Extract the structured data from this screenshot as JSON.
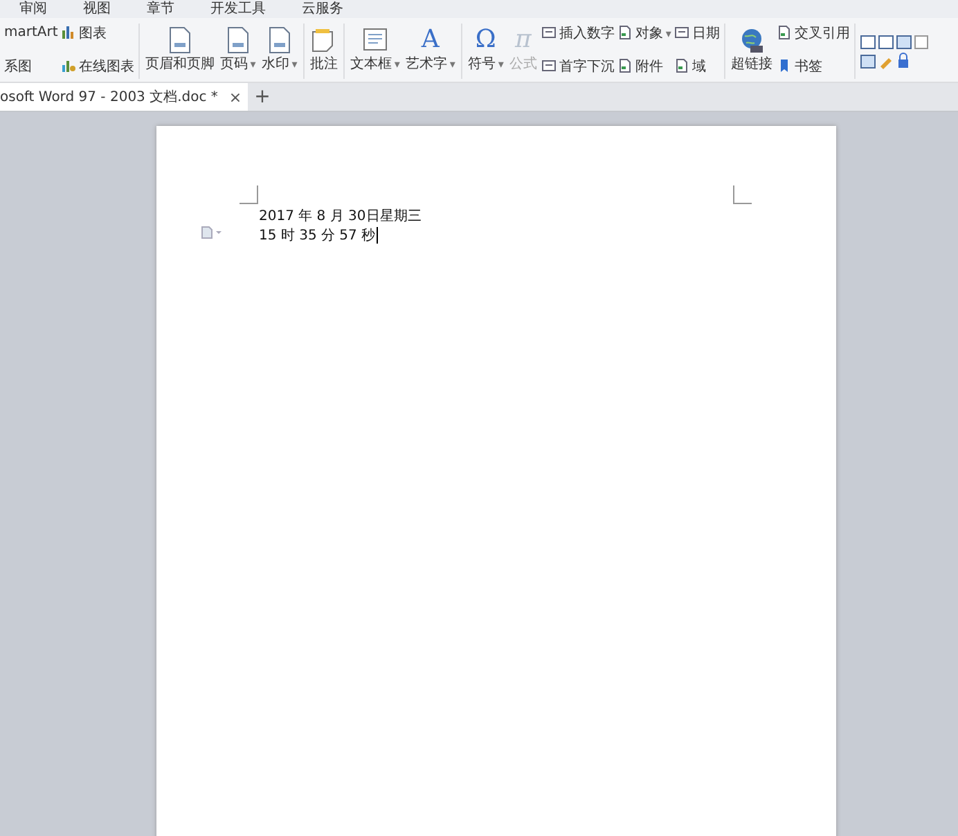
{
  "menu_tabs": [
    "审阅",
    "视图",
    "章节",
    "开发工具",
    "云服务"
  ],
  "ribbon_groups": [
    {
      "columns": [
        [
          {
            "label": "martArt",
            "kind": "small",
            "disabled": false
          },
          {
            "label": "系图",
            "kind": "small",
            "disabled": false
          }
        ],
        [
          {
            "label": "图表",
            "kind": "small",
            "disabled": false
          },
          {
            "label": "在线图表",
            "kind": "small",
            "disabled": false
          }
        ]
      ]
    },
    {
      "columns": [
        [
          {
            "label": "页眉和页脚",
            "kind": "large",
            "disabled": false
          }
        ],
        [
          {
            "label": "页码",
            "kind": "large",
            "arrow": "▾",
            "disabled": false
          }
        ],
        [
          {
            "label": "水印",
            "kind": "large",
            "arrow": "▾",
            "disabled": false
          }
        ]
      ]
    },
    {
      "columns": [
        [
          {
            "label": "批注",
            "kind": "large",
            "disabled": false
          }
        ]
      ]
    },
    {
      "columns": [
        [
          {
            "label": "文本框",
            "kind": "large",
            "arrow": "▾",
            "disabled": false
          }
        ],
        [
          {
            "label": "艺术字",
            "kind": "large",
            "glyph": "A",
            "arrow": "▾",
            "disabled": false
          }
        ]
      ]
    },
    {
      "columns": [
        [
          {
            "label": "符号",
            "kind": "large",
            "glyph": "Ω",
            "arrow": "▾",
            "disabled": false
          }
        ],
        [
          {
            "label": "公式",
            "kind": "large",
            "glyph": "π",
            "disabled": true
          }
        ],
        [
          {
            "label": "插入数字",
            "kind": "small",
            "disabled": false
          },
          {
            "label": "首字下沉",
            "kind": "small",
            "disabled": false
          }
        ],
        [
          {
            "label": "对象",
            "kind": "small",
            "arrow": "▾",
            "disabled": false
          },
          {
            "label": "附件",
            "kind": "small",
            "disabled": false
          }
        ],
        [
          {
            "label": "日期",
            "kind": "small",
            "disabled": false
          },
          {
            "label": "域",
            "kind": "small",
            "disabled": false
          }
        ]
      ]
    },
    {
      "columns": [
        [
          {
            "label": "超链接",
            "kind": "large",
            "disabled": false
          }
        ],
        [
          {
            "label": "交叉引用",
            "kind": "small",
            "disabled": false
          },
          {
            "label": "书签",
            "kind": "small",
            "disabled": false
          }
        ]
      ]
    }
  ],
  "document_tab": {
    "title": "osoft Word 97 - 2003 文档.doc *",
    "close": "×"
  },
  "new_tab": "+",
  "document_lines": [
    "2017 年 8 月 30日星期三",
    "15 时 35 分 57 秒"
  ]
}
